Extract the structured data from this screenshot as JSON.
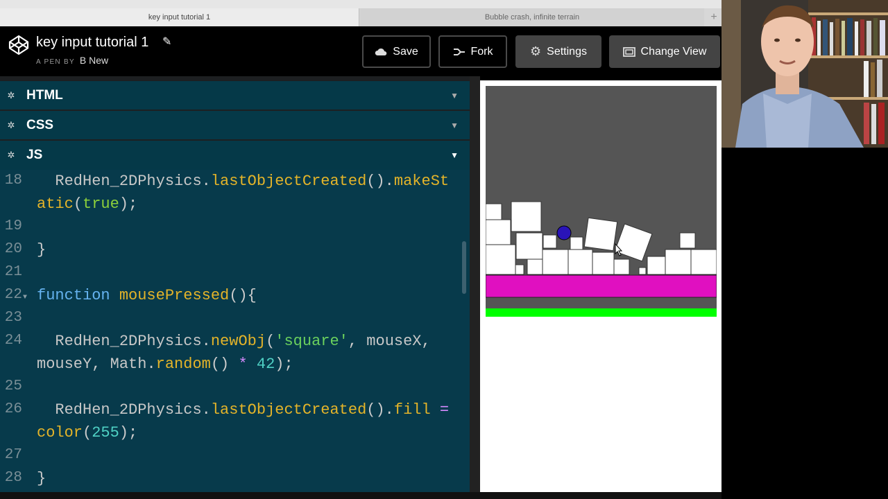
{
  "browser": {
    "tabs": [
      {
        "label": "key input tutorial 1"
      },
      {
        "label": "Bubble crash, infinite terrain"
      }
    ],
    "new_tab_symbol": "+"
  },
  "header": {
    "title": "key input tutorial 1",
    "pen_by": "A PEN BY",
    "author": "B New",
    "buttons": {
      "save": "Save",
      "fork": "Fork",
      "settings": "Settings",
      "change_view": "Change View"
    }
  },
  "editor": {
    "panels": [
      {
        "label": "HTML",
        "collapsed": true
      },
      {
        "label": "CSS",
        "collapsed": true
      },
      {
        "label": "JS",
        "collapsed": false
      }
    ],
    "lines": [
      {
        "n": "18",
        "t": "  RedHen_2DPhysics.lastObjectCreated().makeSt"
      },
      {
        "n": "",
        "t": "atic(true);"
      },
      {
        "n": "19",
        "t": ""
      },
      {
        "n": "20",
        "t": "}"
      },
      {
        "n": "21",
        "t": ""
      },
      {
        "n": "22",
        "t": "function mousePressed(){"
      },
      {
        "n": "23",
        "t": ""
      },
      {
        "n": "24",
        "t": "  RedHen_2DPhysics.newObj('square', mouseX,"
      },
      {
        "n": "",
        "t": "mouseY, Math.random() * 42);"
      },
      {
        "n": "25",
        "t": ""
      },
      {
        "n": "26",
        "t": "  RedHen_2DPhysics.lastObjectCreated().fill ="
      },
      {
        "n": "",
        "t": "color(255);"
      },
      {
        "n": "27",
        "t": ""
      },
      {
        "n": "28",
        "t": "}"
      }
    ]
  },
  "preview": {
    "colors": {
      "sky": "#555555",
      "ground": "#e010c0",
      "strip": "#00ff00",
      "ball": "#2a14b8"
    }
  },
  "icons": {
    "logo": "codepen-logo-icon",
    "edit": "pencil-icon",
    "save": "cloud-icon",
    "fork": "fork-icon",
    "settings": "gear-icon",
    "change_view": "view-icon"
  }
}
